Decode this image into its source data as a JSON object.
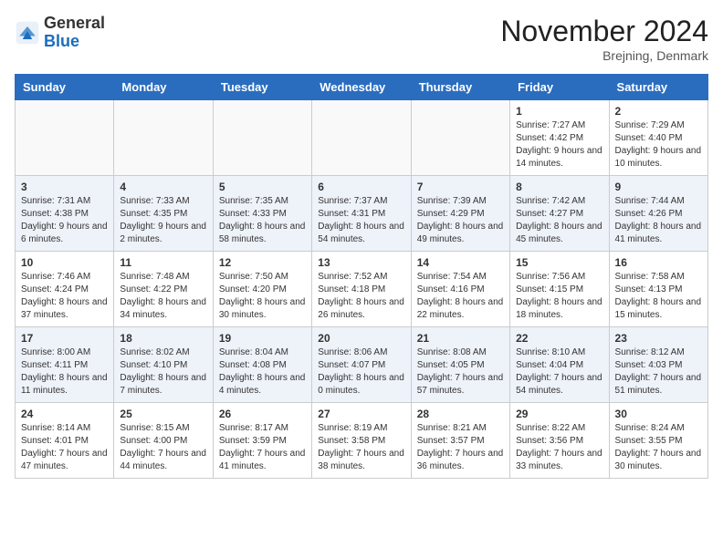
{
  "header": {
    "logo_general": "General",
    "logo_blue": "Blue",
    "title": "November 2024",
    "location": "Brejning, Denmark"
  },
  "days_of_week": [
    "Sunday",
    "Monday",
    "Tuesday",
    "Wednesday",
    "Thursday",
    "Friday",
    "Saturday"
  ],
  "weeks": [
    [
      {
        "day": "",
        "info": ""
      },
      {
        "day": "",
        "info": ""
      },
      {
        "day": "",
        "info": ""
      },
      {
        "day": "",
        "info": ""
      },
      {
        "day": "",
        "info": ""
      },
      {
        "day": "1",
        "info": "Sunrise: 7:27 AM\nSunset: 4:42 PM\nDaylight: 9 hours and 14 minutes."
      },
      {
        "day": "2",
        "info": "Sunrise: 7:29 AM\nSunset: 4:40 PM\nDaylight: 9 hours and 10 minutes."
      }
    ],
    [
      {
        "day": "3",
        "info": "Sunrise: 7:31 AM\nSunset: 4:38 PM\nDaylight: 9 hours and 6 minutes."
      },
      {
        "day": "4",
        "info": "Sunrise: 7:33 AM\nSunset: 4:35 PM\nDaylight: 9 hours and 2 minutes."
      },
      {
        "day": "5",
        "info": "Sunrise: 7:35 AM\nSunset: 4:33 PM\nDaylight: 8 hours and 58 minutes."
      },
      {
        "day": "6",
        "info": "Sunrise: 7:37 AM\nSunset: 4:31 PM\nDaylight: 8 hours and 54 minutes."
      },
      {
        "day": "7",
        "info": "Sunrise: 7:39 AM\nSunset: 4:29 PM\nDaylight: 8 hours and 49 minutes."
      },
      {
        "day": "8",
        "info": "Sunrise: 7:42 AM\nSunset: 4:27 PM\nDaylight: 8 hours and 45 minutes."
      },
      {
        "day": "9",
        "info": "Sunrise: 7:44 AM\nSunset: 4:26 PM\nDaylight: 8 hours and 41 minutes."
      }
    ],
    [
      {
        "day": "10",
        "info": "Sunrise: 7:46 AM\nSunset: 4:24 PM\nDaylight: 8 hours and 37 minutes."
      },
      {
        "day": "11",
        "info": "Sunrise: 7:48 AM\nSunset: 4:22 PM\nDaylight: 8 hours and 34 minutes."
      },
      {
        "day": "12",
        "info": "Sunrise: 7:50 AM\nSunset: 4:20 PM\nDaylight: 8 hours and 30 minutes."
      },
      {
        "day": "13",
        "info": "Sunrise: 7:52 AM\nSunset: 4:18 PM\nDaylight: 8 hours and 26 minutes."
      },
      {
        "day": "14",
        "info": "Sunrise: 7:54 AM\nSunset: 4:16 PM\nDaylight: 8 hours and 22 minutes."
      },
      {
        "day": "15",
        "info": "Sunrise: 7:56 AM\nSunset: 4:15 PM\nDaylight: 8 hours and 18 minutes."
      },
      {
        "day": "16",
        "info": "Sunrise: 7:58 AM\nSunset: 4:13 PM\nDaylight: 8 hours and 15 minutes."
      }
    ],
    [
      {
        "day": "17",
        "info": "Sunrise: 8:00 AM\nSunset: 4:11 PM\nDaylight: 8 hours and 11 minutes."
      },
      {
        "day": "18",
        "info": "Sunrise: 8:02 AM\nSunset: 4:10 PM\nDaylight: 8 hours and 7 minutes."
      },
      {
        "day": "19",
        "info": "Sunrise: 8:04 AM\nSunset: 4:08 PM\nDaylight: 8 hours and 4 minutes."
      },
      {
        "day": "20",
        "info": "Sunrise: 8:06 AM\nSunset: 4:07 PM\nDaylight: 8 hours and 0 minutes."
      },
      {
        "day": "21",
        "info": "Sunrise: 8:08 AM\nSunset: 4:05 PM\nDaylight: 7 hours and 57 minutes."
      },
      {
        "day": "22",
        "info": "Sunrise: 8:10 AM\nSunset: 4:04 PM\nDaylight: 7 hours and 54 minutes."
      },
      {
        "day": "23",
        "info": "Sunrise: 8:12 AM\nSunset: 4:03 PM\nDaylight: 7 hours and 51 minutes."
      }
    ],
    [
      {
        "day": "24",
        "info": "Sunrise: 8:14 AM\nSunset: 4:01 PM\nDaylight: 7 hours and 47 minutes."
      },
      {
        "day": "25",
        "info": "Sunrise: 8:15 AM\nSunset: 4:00 PM\nDaylight: 7 hours and 44 minutes."
      },
      {
        "day": "26",
        "info": "Sunrise: 8:17 AM\nSunset: 3:59 PM\nDaylight: 7 hours and 41 minutes."
      },
      {
        "day": "27",
        "info": "Sunrise: 8:19 AM\nSunset: 3:58 PM\nDaylight: 7 hours and 38 minutes."
      },
      {
        "day": "28",
        "info": "Sunrise: 8:21 AM\nSunset: 3:57 PM\nDaylight: 7 hours and 36 minutes."
      },
      {
        "day": "29",
        "info": "Sunrise: 8:22 AM\nSunset: 3:56 PM\nDaylight: 7 hours and 33 minutes."
      },
      {
        "day": "30",
        "info": "Sunrise: 8:24 AM\nSunset: 3:55 PM\nDaylight: 7 hours and 30 minutes."
      }
    ]
  ]
}
